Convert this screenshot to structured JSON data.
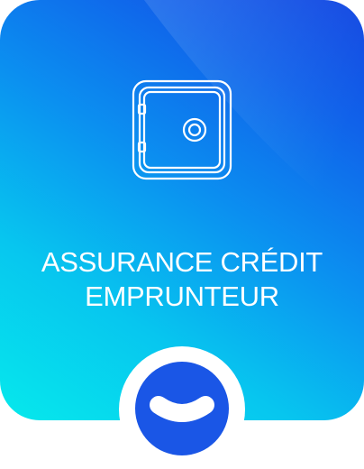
{
  "card": {
    "title_line1": "ASSURANCE CRÉDIT",
    "title_line2": "EMPRUNTEUR",
    "icon": "safe-icon",
    "toggle_icon": "chevron-down-icon"
  },
  "colors": {
    "gradient_start": "#06e9ec",
    "gradient_end": "#1447e2",
    "button": "#1a56e6",
    "text": "#ffffff"
  }
}
